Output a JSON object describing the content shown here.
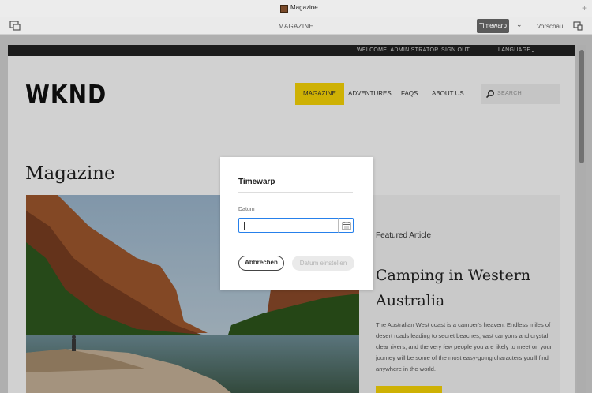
{
  "window": {
    "title": "Magazine"
  },
  "editor": {
    "center_title": "MAGAZINE",
    "timewarp_label": "Timewarp",
    "preview_label": "Vorschau"
  },
  "site": {
    "topbar": {
      "welcome": "WELCOME, ADMINISTRATOR",
      "signout": "SIGN OUT",
      "language": "LANGUAGE"
    },
    "logo": "WKND",
    "nav": [
      "MAGAZINE",
      "ADVENTURES",
      "FAQS",
      "ABOUT US"
    ],
    "search_placeholder": "SEARCH",
    "page_title": "Magazine",
    "featured": {
      "label": "Featured Article",
      "title": "Camping in Western Australia",
      "description": "The Australian West coast is a camper's heaven. Endless miles of desert roads leading to secret beaches, vast canyons and crystal clear rivers, and the very few people you are likely to meet on your journey will be some of the most easy-going characters you'll find anywhere in the world."
    }
  },
  "dialog": {
    "title": "Timewarp",
    "field_label": "Datum",
    "field_value": "",
    "cancel_label": "Abbrechen",
    "confirm_label": "Datum einstellen"
  },
  "colors": {
    "accent": "#fcd805",
    "focus": "#2680eb"
  }
}
